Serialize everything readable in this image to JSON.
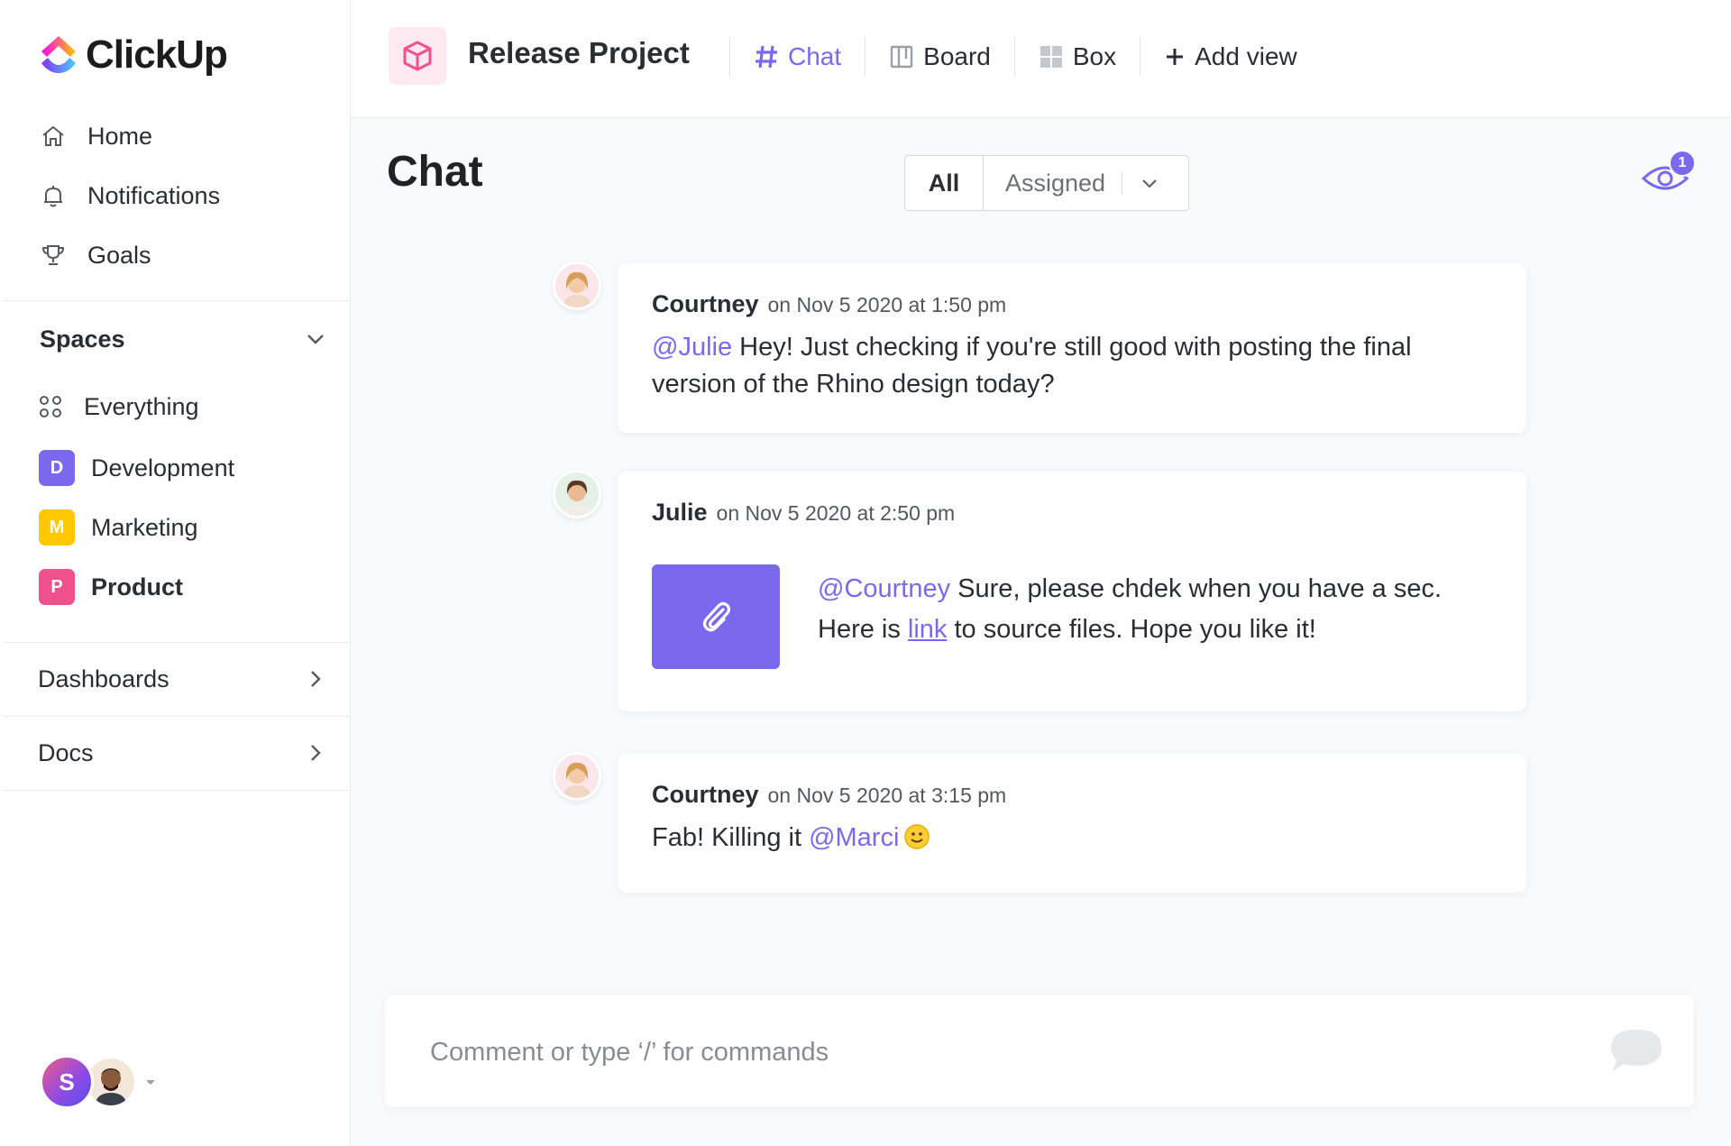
{
  "brand": {
    "name": "ClickUp"
  },
  "sidebar": {
    "nav": [
      {
        "label": "Home",
        "icon": "home-icon"
      },
      {
        "label": "Notifications",
        "icon": "bell-icon"
      },
      {
        "label": "Goals",
        "icon": "trophy-icon"
      }
    ],
    "spaces_title": "Spaces",
    "everything_label": "Everything",
    "spaces": [
      {
        "letter": "D",
        "label": "Development",
        "color": "#7b68ee"
      },
      {
        "letter": "M",
        "label": "Marketing",
        "color": "#ffc800"
      },
      {
        "letter": "P",
        "label": "Product",
        "color": "#f0508c"
      }
    ],
    "dashboards_label": "Dashboards",
    "docs_label": "Docs",
    "user_initial": "S"
  },
  "topbar": {
    "project_title": "Release Project",
    "views": [
      {
        "label": "Chat",
        "icon": "hash-icon",
        "active": true
      },
      {
        "label": "Board",
        "icon": "board-icon"
      },
      {
        "label": "Box",
        "icon": "grid-icon"
      },
      {
        "label": "Add view",
        "icon": "plus-icon"
      }
    ]
  },
  "main": {
    "title": "Chat",
    "filter": {
      "all_label": "All",
      "assigned_label": "Assigned"
    },
    "watchers_count": "1",
    "messages": [
      {
        "author": "Courtney",
        "timestamp": "on Nov 5 2020 at 1:50 pm",
        "mention": "@Julie",
        "text": " Hey! Just checking if you're still good with posting the final version of the Rhino design today?"
      },
      {
        "author": "Julie",
        "timestamp": "on Nov 5 2020 at 2:50 pm",
        "mention": "@Courtney",
        "text_a": " Sure, please chdek when you have a sec. Here is ",
        "link": "link",
        "text_b": " to source files. Hope you like it!"
      },
      {
        "author": "Courtney",
        "timestamp": "on Nov 5 2020 at 3:15 pm",
        "text": "Fab! Killing it ",
        "mention": "@Marci"
      }
    ],
    "composer": {
      "placeholder": "Comment or type ‘/’ for commands"
    }
  },
  "colors": {
    "accent": "#7b68ee",
    "background": "#f9fafb"
  }
}
